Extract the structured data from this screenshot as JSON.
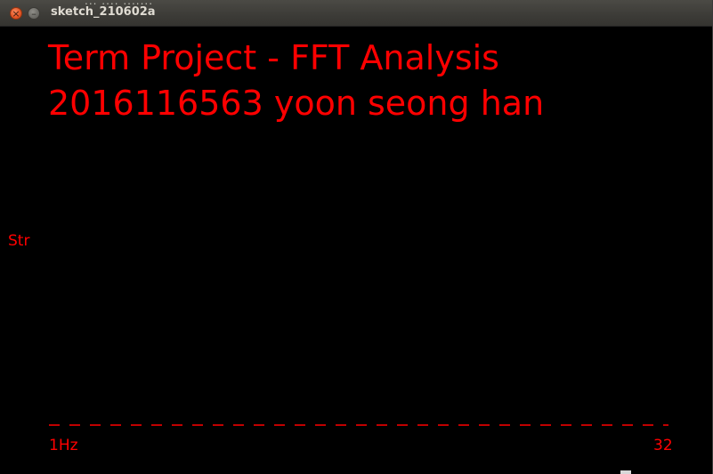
{
  "window": {
    "title": "sketch_210602a",
    "close_glyph": "×",
    "minimize_glyph": "–",
    "background_text": "... .... ......."
  },
  "sketch": {
    "title_line1": "Term Project - FFT Analysis",
    "title_line2": "2016116563 yoon seong han",
    "y_axis_label": "Str",
    "x_axis_start_label": "1Hz",
    "x_axis_end_label": "32",
    "text_color": "#ff0000",
    "background_color": "#000000"
  },
  "chart_data": {
    "type": "bar",
    "categories": [],
    "values": [],
    "title": "",
    "xlabel": "",
    "ylabel": "Str",
    "x_range_labels": [
      "1Hz",
      "32"
    ],
    "baseline_style": "dashed",
    "grid": false
  }
}
